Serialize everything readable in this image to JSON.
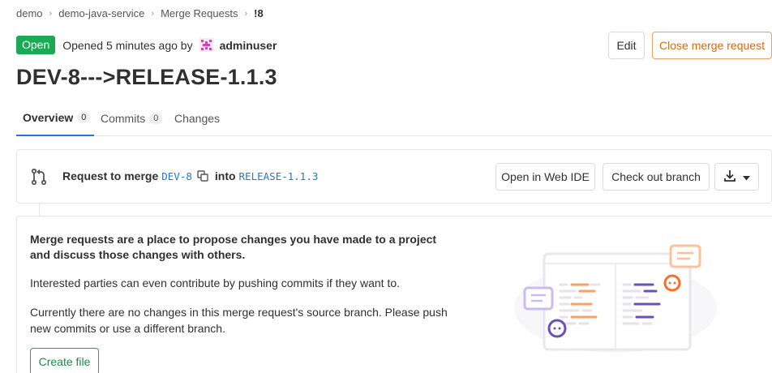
{
  "breadcrumb": {
    "items": [
      "demo",
      "demo-java-service",
      "Merge Requests",
      "!8"
    ]
  },
  "header": {
    "status": "Open",
    "opened_text": "Opened 5 minutes ago by",
    "author": "adminuser",
    "edit_label": "Edit",
    "close_label": "Close merge request"
  },
  "title": "DEV-8--->RELEASE-1.1.3",
  "tabs": [
    {
      "label": "Overview",
      "count": "0"
    },
    {
      "label": "Commits",
      "count": "0"
    },
    {
      "label": "Changes"
    }
  ],
  "widget": {
    "request_text": "Request to merge",
    "source_branch": "DEV-8",
    "into_text": "into",
    "target_branch": "RELEASE-1.1.3",
    "web_ide_label": "Open in Web IDE",
    "checkout_label": "Check out branch"
  },
  "empty_state": {
    "heading": "Merge requests are a place to propose changes you have made to a project and discuss those changes with others.",
    "paragraph1": "Interested parties can even contribute by pushing commits if they want to.",
    "paragraph2": "Currently there are no changes in this merge request's source branch. Please push new commits or use a different branch.",
    "create_file_label": "Create file"
  },
  "colors": {
    "open_badge": "#1aaa55",
    "close_button": "#d66a12",
    "branch_link": "#1f78d1",
    "active_tab": "#1f78d1"
  },
  "icons": [
    "avatar-icon",
    "merge-request-icon",
    "copy-icon",
    "download-icon",
    "caret-down-icon",
    "chevron-right-icon"
  ]
}
